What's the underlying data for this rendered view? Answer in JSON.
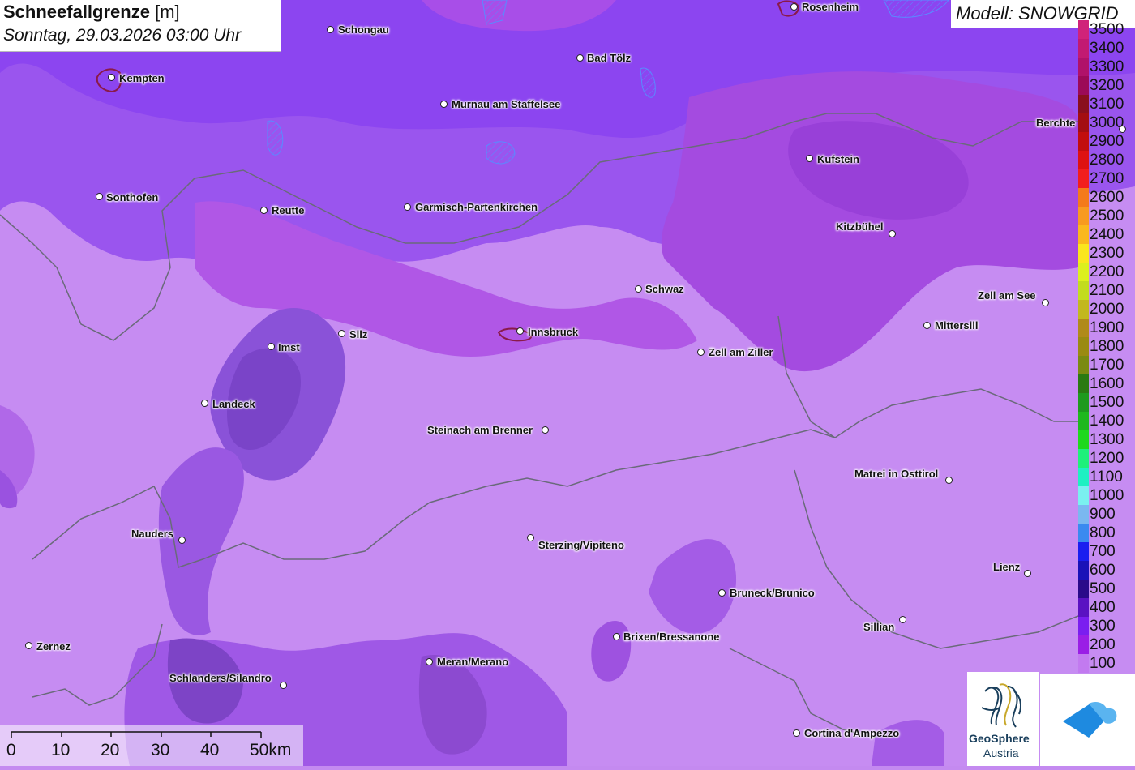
{
  "header": {
    "title": "Schneefallgrenze",
    "unit": "[m]",
    "datetime": "Sonntag, 29.03.2026 03:00 Uhr",
    "model": "Modell: SNOWGRID"
  },
  "legend": [
    {
      "label": "3500",
      "color": "#d0237a"
    },
    {
      "label": "3400",
      "color": "#c21a72"
    },
    {
      "label": "3300",
      "color": "#b0126a"
    },
    {
      "label": "3200",
      "color": "#9c0a58"
    },
    {
      "label": "3100",
      "color": "#8a0f1e"
    },
    {
      "label": "3000",
      "color": "#a40e12"
    },
    {
      "label": "2900",
      "color": "#c20e0e"
    },
    {
      "label": "2800",
      "color": "#de1212"
    },
    {
      "label": "2700",
      "color": "#f21e1e"
    },
    {
      "label": "2600",
      "color": "#f47a1a"
    },
    {
      "label": "2500",
      "color": "#f89a20"
    },
    {
      "label": "2400",
      "color": "#fab81e"
    },
    {
      "label": "2300",
      "color": "#fae61e"
    },
    {
      "label": "2200",
      "color": "#dcf01e"
    },
    {
      "label": "2100",
      "color": "#c2dc1e"
    },
    {
      "label": "2000",
      "color": "#c2b81e"
    },
    {
      "label": "1900",
      "color": "#b08a1a"
    },
    {
      "label": "1800",
      "color": "#9a8a12"
    },
    {
      "label": "1700",
      "color": "#7a8a12"
    },
    {
      "label": "1600",
      "color": "#2a7a12"
    },
    {
      "label": "1500",
      "color": "#1e9a1e"
    },
    {
      "label": "1400",
      "color": "#1eb81e"
    },
    {
      "label": "1300",
      "color": "#1ed81e"
    },
    {
      "label": "1200",
      "color": "#1ef07a"
    },
    {
      "label": "1100",
      "color": "#1ef0c2"
    },
    {
      "label": "1000",
      "color": "#7af0f0"
    },
    {
      "label": "900",
      "color": "#7ab8f0"
    },
    {
      "label": "800",
      "color": "#3a8af0"
    },
    {
      "label": "700",
      "color": "#1a1ef0"
    },
    {
      "label": "600",
      "color": "#1a12b8"
    },
    {
      "label": "500",
      "color": "#2a0a8a"
    },
    {
      "label": "400",
      "color": "#5a12c2"
    },
    {
      "label": "300",
      "color": "#7a1ef0"
    },
    {
      "label": "200",
      "color": "#9a1ee6"
    },
    {
      "label": "100",
      "color": "#c27af0"
    }
  ],
  "cities": [
    {
      "name": "Rosenheim",
      "label": "Rosenheim"
    },
    {
      "name": "Schongau",
      "label": "Schongau"
    },
    {
      "name": "Bad Tölz",
      "label": "Bad Tölz"
    },
    {
      "name": "Kempten",
      "label": "Kempten"
    },
    {
      "name": "Murnau am Staffelsee",
      "label": "Murnau am Staffelsee"
    },
    {
      "name": "Berchtesgaden",
      "label": "Berchte"
    },
    {
      "name": "Kufstein",
      "label": "Kufstein"
    },
    {
      "name": "Sonthofen",
      "label": "Sonthofen"
    },
    {
      "name": "Reutte",
      "label": "Reutte"
    },
    {
      "name": "Garmisch-Partenkirchen",
      "label": "Garmisch-Partenkirchen"
    },
    {
      "name": "Kitzbühel",
      "label": "Kitzbühel"
    },
    {
      "name": "Schwaz",
      "label": "Schwaz"
    },
    {
      "name": "Zell am See",
      "label": "Zell am See"
    },
    {
      "name": "Imst",
      "label": "Imst"
    },
    {
      "name": "Silz",
      "label": "Silz"
    },
    {
      "name": "Innsbruck",
      "label": "Innsbruck"
    },
    {
      "name": "Mittersill",
      "label": "Mittersill"
    },
    {
      "name": "Zell am Ziller",
      "label": "Zell am Ziller"
    },
    {
      "name": "Landeck",
      "label": "Landeck"
    },
    {
      "name": "Steinach am Brenner",
      "label": "Steinach am Brenner"
    },
    {
      "name": "Matrei in Osttirol",
      "label": "Matrei in Osttirol"
    },
    {
      "name": "Nauders",
      "label": "Nauders"
    },
    {
      "name": "Sterzing/Vipiteno",
      "label": "Sterzing/Vipiteno"
    },
    {
      "name": "Lienz",
      "label": "Lienz"
    },
    {
      "name": "Bruneck/Brunico",
      "label": "Bruneck/Brunico"
    },
    {
      "name": "Sillian",
      "label": "Sillian"
    },
    {
      "name": "Brixen/Bressanone",
      "label": "Brixen/Bressanone"
    },
    {
      "name": "Zernez",
      "label": "Zernez"
    },
    {
      "name": "Meran/Merano",
      "label": "Meran/Merano"
    },
    {
      "name": "Schlanders/Silandro",
      "label": "Schlanders/Silandro"
    },
    {
      "name": "Cortina d'Ampezzo",
      "label": "Cortina d'Ampezzo"
    }
  ],
  "scale_bar": {
    "labels": [
      "0",
      "10",
      "20",
      "30",
      "40",
      "50km"
    ]
  },
  "logos": {
    "geosphere_line1": "GeoSphere",
    "geosphere_line2": "Austria"
  },
  "icons": {
    "geosphere": "geosphere-logo-icon",
    "cloud": "cloud-logo-icon"
  }
}
